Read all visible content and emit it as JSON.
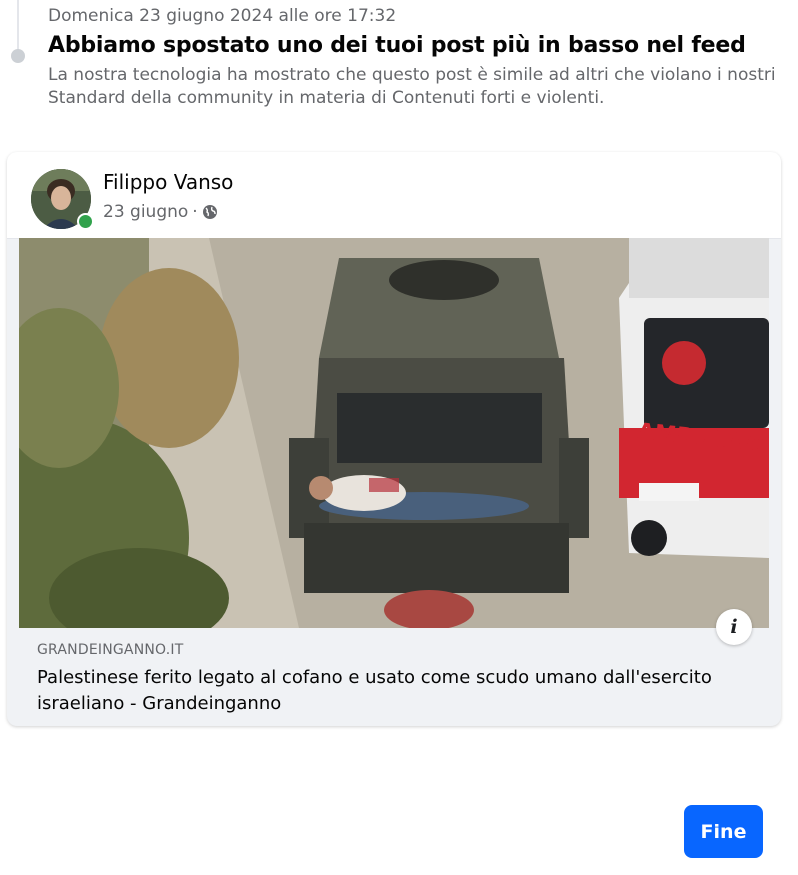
{
  "notice": {
    "date": "Domenica 23 giugno 2024 alle ore 17:32",
    "title": "Abbiamo spostato uno dei tuoi post più in basso nel feed",
    "description": "La nostra tecnologia ha mostrato che questo post è simile ad altri che violano i nostri Standard della community in materia di Contenuti forti e violenti."
  },
  "post": {
    "author": "Filippo Vanso",
    "date": "23 giugno",
    "separator": "·",
    "audience_icon": "globe-icon",
    "author_online": true,
    "link": {
      "domain": "GRANDEINGANNO.IT",
      "title": "Palestinese ferito legato al cofano e usato come scudo umano dall'esercito israeliano - Grandeinganno",
      "image_text": "AMBULANC",
      "info_label": "i"
    }
  },
  "actions": {
    "done_label": "Fine"
  },
  "colors": {
    "primary": "#0866ff",
    "online": "#31a24c",
    "secondary_text": "#65676b",
    "ambulance_red": "#d22630"
  }
}
